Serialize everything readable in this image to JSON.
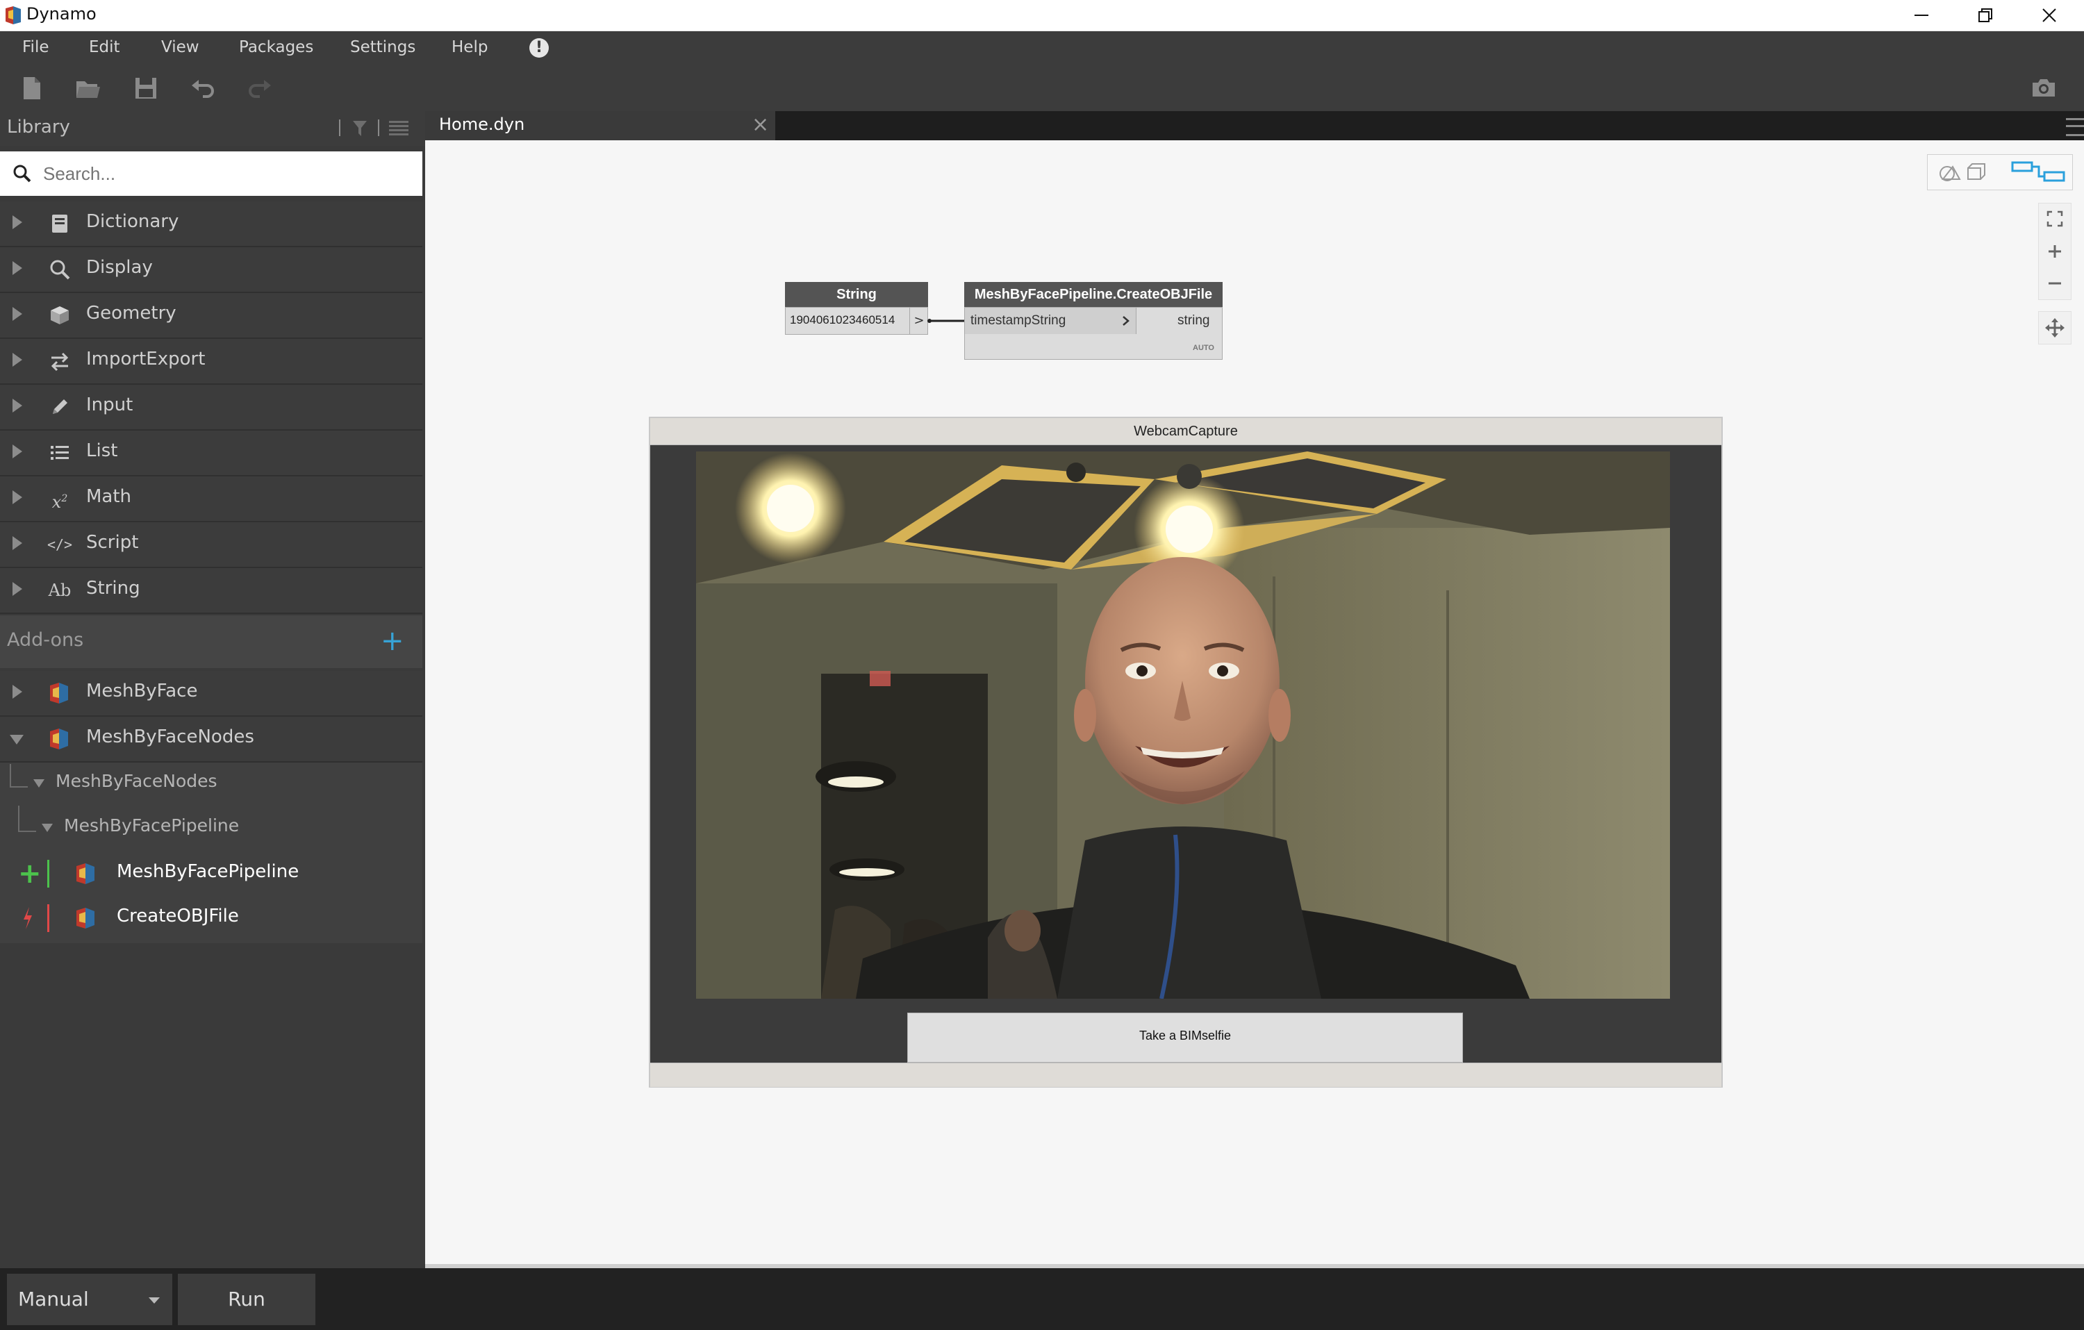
{
  "window": {
    "title": "Dynamo",
    "icons": [
      "dynamo-logo-icon",
      "minimize-icon",
      "restore-icon",
      "close-icon"
    ]
  },
  "menu": {
    "items": [
      "File",
      "Edit",
      "View",
      "Packages",
      "Settings",
      "Help"
    ],
    "alert": "!"
  },
  "toolbar": {
    "icons": [
      "new-file-icon",
      "open-file-icon",
      "save-icon",
      "undo-icon",
      "redo-icon",
      "camera-icon"
    ]
  },
  "library": {
    "title": "Library",
    "search_placeholder": "Search...",
    "categories": [
      {
        "label": "Dictionary",
        "icon": "dictionary-icon"
      },
      {
        "label": "Display",
        "icon": "magnifier-icon"
      },
      {
        "label": "Geometry",
        "icon": "cube-icon"
      },
      {
        "label": "ImportExport",
        "icon": "import-export-icon"
      },
      {
        "label": "Input",
        "icon": "pencil-icon"
      },
      {
        "label": "List",
        "icon": "list-icon"
      },
      {
        "label": "Math",
        "icon": "math-icon"
      },
      {
        "label": "Script",
        "icon": "code-icon"
      },
      {
        "label": "String",
        "icon": "text-icon"
      }
    ],
    "addons_label": "Add-ons",
    "addons_plus": "+",
    "addons": [
      {
        "label": "MeshByFace",
        "expanded": false
      },
      {
        "label": "MeshByFaceNodes",
        "expanded": true
      }
    ],
    "tree": {
      "level1": "MeshByFaceNodes",
      "level2": "MeshByFacePipeline",
      "create_node": "MeshByFacePipeline",
      "action_node": "CreateOBJFile"
    }
  },
  "workspace": {
    "tab_label": "Home.dyn",
    "tab_close": "×",
    "string_node": {
      "title": "String",
      "value": "1904061023460514",
      "port_symbol": ">"
    },
    "pipeline_node": {
      "title": "MeshByFacePipeline.CreateOBJFile",
      "input_port": "timestampString",
      "output_port": "string",
      "lacing": "AUTO"
    },
    "webcam_node": {
      "title": "WebcamCapture",
      "button_label": "Take a BIMselfie"
    }
  },
  "run": {
    "mode": "Manual",
    "button": "Run"
  },
  "colors": {
    "menu_bg": "#3c3c3c",
    "panel_bg": "#3a3a3a",
    "accent_blue": "#37a3d6",
    "add_green": "#4cc24c",
    "action_red": "#e04848"
  }
}
